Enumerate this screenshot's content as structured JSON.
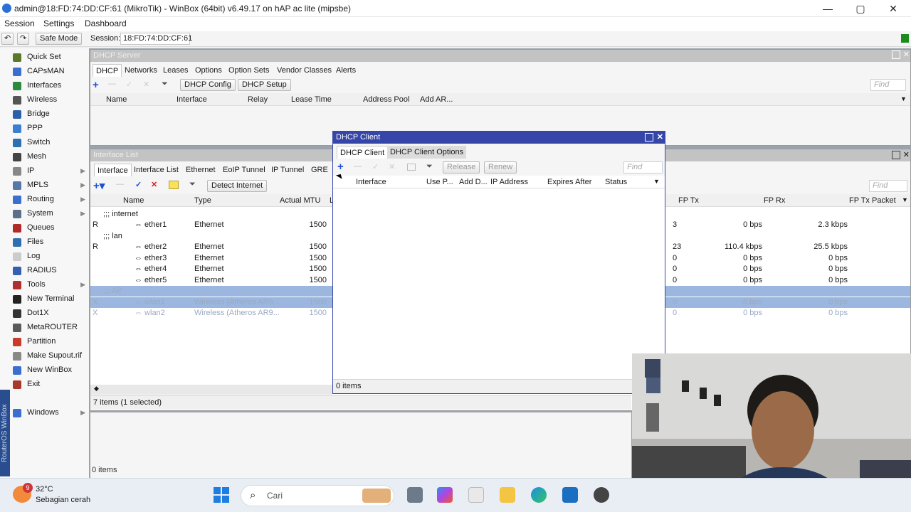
{
  "window": {
    "title": "admin@18:FD:74:DD:CF:61 (MikroTik) - WinBox (64bit) v6.49.17 on hAP ac lite (mipsbe)",
    "min": "—",
    "max": "▢",
    "close": "✕"
  },
  "menu": [
    "Session",
    "Settings",
    "Dashboard"
  ],
  "toolbar": {
    "safe_mode": "Safe Mode",
    "session_label": "Session:",
    "session_value": "18:FD:74:DD:CF:61",
    "undo": "↶",
    "redo": "↷"
  },
  "sidebar": {
    "vertical_label": "RouterOS WinBox",
    "items": [
      {
        "label": "Quick Set",
        "icon": "wand-icon",
        "color": "#5a7a2a",
        "arrow": ""
      },
      {
        "label": "CAPsMAN",
        "icon": "capsman-icon",
        "color": "#3a6fcf",
        "arrow": ""
      },
      {
        "label": "Interfaces",
        "icon": "interfaces-icon",
        "color": "#2b8a3e",
        "arrow": ""
      },
      {
        "label": "Wireless",
        "icon": "wireless-icon",
        "color": "#555555",
        "arrow": ""
      },
      {
        "label": "Bridge",
        "icon": "bridge-icon",
        "color": "#2b5fa8",
        "arrow": ""
      },
      {
        "label": "PPP",
        "icon": "ppp-icon",
        "color": "#3a7fd0",
        "arrow": ""
      },
      {
        "label": "Switch",
        "icon": "switch-icon",
        "color": "#2d6fb0",
        "arrow": ""
      },
      {
        "label": "Mesh",
        "icon": "mesh-icon",
        "color": "#444444",
        "arrow": ""
      },
      {
        "label": "IP",
        "icon": "ip-icon",
        "color": "#888888",
        "arrow": "▶"
      },
      {
        "label": "MPLS",
        "icon": "mpls-icon",
        "color": "#5577aa",
        "arrow": "▶"
      },
      {
        "label": "Routing",
        "icon": "routing-icon",
        "color": "#3a6fcf",
        "arrow": "▶"
      },
      {
        "label": "System",
        "icon": "system-icon",
        "color": "#5b6f8a",
        "arrow": "▶"
      },
      {
        "label": "Queues",
        "icon": "queues-icon",
        "color": "#b02a2a",
        "arrow": ""
      },
      {
        "label": "Files",
        "icon": "files-icon",
        "color": "#2d6fb0",
        "arrow": ""
      },
      {
        "label": "Log",
        "icon": "log-icon",
        "color": "#cccccc",
        "arrow": ""
      },
      {
        "label": "RADIUS",
        "icon": "radius-icon",
        "color": "#3560b0",
        "arrow": ""
      },
      {
        "label": "Tools",
        "icon": "tools-icon",
        "color": "#b03030",
        "arrow": "▶"
      },
      {
        "label": "New Terminal",
        "icon": "terminal-icon",
        "color": "#222222",
        "arrow": ""
      },
      {
        "label": "Dot1X",
        "icon": "dot1x-icon",
        "color": "#333333",
        "arrow": ""
      },
      {
        "label": "MetaROUTER",
        "icon": "metarouter-icon",
        "color": "#5a5a5a",
        "arrow": ""
      },
      {
        "label": "Partition",
        "icon": "partition-icon",
        "color": "#c83a2a",
        "arrow": ""
      },
      {
        "label": "Make Supout.rif",
        "icon": "supout-icon",
        "color": "#888888",
        "arrow": ""
      },
      {
        "label": "New WinBox",
        "icon": "winbox-icon",
        "color": "#3a6fcf",
        "arrow": ""
      },
      {
        "label": "Exit",
        "icon": "exit-icon",
        "color": "#a83a2a",
        "arrow": ""
      },
      {
        "label": "Windows",
        "icon": "windows-icon",
        "color": "#3a6fcf",
        "arrow": "▶"
      }
    ]
  },
  "dhcp_server": {
    "title": "DHCP Server",
    "tabs": [
      "DHCP",
      "Networks",
      "Leases",
      "Options",
      "Option Sets",
      "Vendor Classes",
      "Alerts"
    ],
    "buttons": {
      "config": "DHCP Config",
      "setup": "DHCP Setup"
    },
    "find": "Find",
    "columns": [
      "Name",
      "Interface",
      "Relay",
      "Lease Time",
      "Address Pool",
      "Add AR..."
    ]
  },
  "interface_list": {
    "title": "Interface List",
    "tabs": [
      "Interface",
      "Interface List",
      "Ethernet",
      "EoIP Tunnel",
      "IP Tunnel",
      "GRE"
    ],
    "detect": "Detect Internet",
    "find": "Find",
    "columns": [
      "Name",
      "Type",
      "Actual MTU",
      "L"
    ],
    "right_columns": [
      "FP Tx",
      "FP Rx",
      "FP Tx Packet"
    ],
    "rows": [
      {
        "flag": "",
        "comment": ";;; internet",
        "name": "",
        "type": "",
        "mtu": "",
        "fptx": "",
        "fprx": "",
        "fppkt": "",
        "sel": false,
        "dis": false
      },
      {
        "flag": "R",
        "comment": "",
        "name": "ether1",
        "type": "Ethernet",
        "mtu": "1500",
        "fptx": "3",
        "fprx": "0 bps",
        "fppkt": "2.3 kbps",
        "sel": false,
        "dis": false
      },
      {
        "flag": "",
        "comment": ";;; lan",
        "name": "",
        "type": "",
        "mtu": "",
        "fptx": "",
        "fprx": "",
        "fppkt": "",
        "sel": false,
        "dis": false
      },
      {
        "flag": "R",
        "comment": "",
        "name": "ether2",
        "type": "Ethernet",
        "mtu": "1500",
        "fptx": "23",
        "fprx": "110.4 kbps",
        "fppkt": "25.5 kbps",
        "sel": false,
        "dis": false
      },
      {
        "flag": "",
        "comment": "",
        "name": "ether3",
        "type": "Ethernet",
        "mtu": "1500",
        "fptx": "0",
        "fprx": "0 bps",
        "fppkt": "0 bps",
        "sel": false,
        "dis": false
      },
      {
        "flag": "",
        "comment": "",
        "name": "ether4",
        "type": "Ethernet",
        "mtu": "1500",
        "fptx": "0",
        "fprx": "0 bps",
        "fppkt": "0 bps",
        "sel": false,
        "dis": false
      },
      {
        "flag": "",
        "comment": "",
        "name": "ether5",
        "type": "Ethernet",
        "mtu": "1500",
        "fptx": "0",
        "fprx": "0 bps",
        "fppkt": "0 bps",
        "sel": false,
        "dis": false
      },
      {
        "flag": "",
        "comment": ";;; AP",
        "name": "",
        "type": "",
        "mtu": "",
        "fptx": "",
        "fprx": "",
        "fppkt": "",
        "sel": true,
        "dis": true
      },
      {
        "flag": "X",
        "comment": "",
        "name": "wlan1",
        "type": "Wireless (Atheros AR9...",
        "mtu": "1500",
        "fptx": "0",
        "fprx": "0 bps",
        "fppkt": "0 bps",
        "sel": true,
        "dis": true
      },
      {
        "flag": "X",
        "comment": "",
        "name": "wlan2",
        "type": "Wireless (Atheros AR9...",
        "mtu": "1500",
        "fptx": "0",
        "fprx": "0 bps",
        "fppkt": "0 bps",
        "sel": false,
        "dis": true
      }
    ],
    "status": "7 items (1 selected)"
  },
  "dhcp_client": {
    "title": "DHCP Client",
    "tabs": [
      "DHCP Client",
      "DHCP Client Options"
    ],
    "buttons": {
      "release": "Release",
      "renew": "Renew"
    },
    "find": "Find",
    "columns": [
      "Interface",
      "Use P...",
      "Add D...",
      "IP Address",
      "Expires After",
      "Status"
    ],
    "status": "0 items"
  },
  "bottom_status": "0 items",
  "taskbar": {
    "temp": "32°C",
    "weather": "Sebagian cerah",
    "search": "Cari",
    "badge": "9"
  }
}
